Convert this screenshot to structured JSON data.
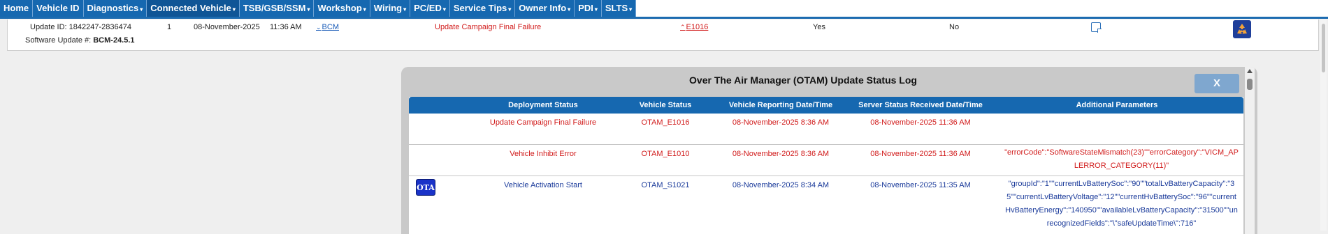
{
  "nav": {
    "items": [
      {
        "label": "Home",
        "dropdown": false
      },
      {
        "label": "Vehicle ID",
        "dropdown": false
      },
      {
        "label": "Diagnostics",
        "dropdown": true
      },
      {
        "label": "Connected Vehicle",
        "dropdown": true,
        "active": true
      },
      {
        "label": "TSB/GSB/SSM",
        "dropdown": true
      },
      {
        "label": "Workshop",
        "dropdown": true
      },
      {
        "label": "Wiring",
        "dropdown": true
      },
      {
        "label": "PC/ED",
        "dropdown": true
      },
      {
        "label": "Service Tips",
        "dropdown": true
      },
      {
        "label": "Owner Info",
        "dropdown": true
      },
      {
        "label": "PDI",
        "dropdown": true
      },
      {
        "label": "SLTS",
        "dropdown": true
      }
    ],
    "caret": "▾"
  },
  "record": {
    "update_id": "Update ID: 1842247-2836474",
    "software_update_label": "Software Update #: ",
    "software_update_value": "BCM-24.5.1",
    "count": "1",
    "date": "08-November-2025",
    "time": "11:36 AM",
    "module": "BCM",
    "status": "Update Campaign Final Failure",
    "code": "E1016",
    "col_yes": "Yes",
    "col_no": "No",
    "chevron": "⌄",
    "chevron_up": "⌃"
  },
  "modal": {
    "title": "Over The Air Manager (OTAM) Update Status Log",
    "close_label": "X",
    "headers": {
      "deployment_status": "Deployment Status",
      "vehicle_status": "Vehicle Status",
      "vehicle_reporting": "Vehicle Reporting Date/Time",
      "server_status": "Server Status Received Date/Time",
      "additional": "Additional Parameters"
    },
    "rows": [
      {
        "deployment_status": "Update Campaign Final Failure",
        "vehicle_status": "OTAM_E1016",
        "vehicle_reporting": "08-November-2025 8:36 AM",
        "server_status": "08-November-2025 11:36 AM",
        "additional": ""
      },
      {
        "deployment_status": "Vehicle Inhibit Error",
        "vehicle_status": "OTAM_E1010",
        "vehicle_reporting": "08-November-2025 8:36 AM",
        "server_status": "08-November-2025 11:36 AM",
        "additional": "\"errorCode\":\"SoftwareStateMismatch(23)\"\"errorCategory\":\"VICM_APLERROR_CATEGORY(11)\""
      },
      {
        "icon_label": "OTA",
        "deployment_status": "Vehicle Activation Start",
        "vehicle_status": "OTAM_S1021",
        "vehicle_reporting": "08-November-2025 8:34 AM",
        "server_status": "08-November-2025 11:35 AM",
        "additional": "\"groupId\":\"1\"\"currentLvBatterySoc\":\"90\"\"totalLvBatteryCapacity\":\"35\"\"currentLvBatteryVoltage\":\"12\"\"currentHvBatterySoc\":\"96\"\"currentHvBatteryEnergy\":\"140950\"\"availableLvBatteryCapacity\":\"31500\"\"unrecognizedFields\":\"\\\"safeUpdateTime\\\":716\""
      }
    ]
  },
  "colors": {
    "nav_blue": "#1668b0",
    "failure_red": "#d11b1b",
    "info_blue": "#1a3a9a",
    "modal_bg": "#c9c9c9"
  }
}
